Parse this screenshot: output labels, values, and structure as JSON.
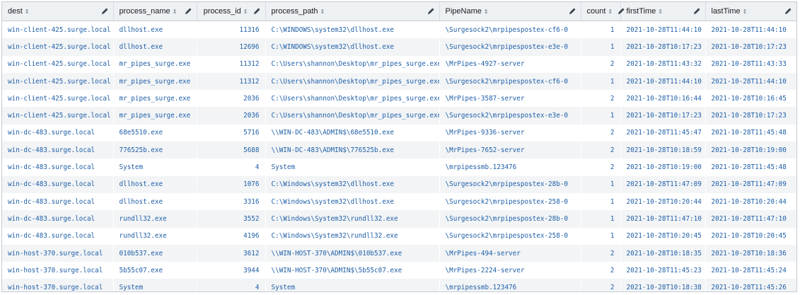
{
  "table": {
    "columns": [
      {
        "label": "dest",
        "sort": "⇕",
        "numeric": false
      },
      {
        "label": "process_name",
        "sort": "⇕",
        "numeric": false
      },
      {
        "label": "process_id",
        "sort": "⇕",
        "numeric": true
      },
      {
        "label": "process_path",
        "sort": "⇕",
        "numeric": false
      },
      {
        "label": "PipeName",
        "sort": "⇕",
        "numeric": false
      },
      {
        "label": "count",
        "sort": "⇕",
        "numeric": true
      },
      {
        "label": "firstTime",
        "sort": "⇕",
        "numeric": false
      },
      {
        "label": "lastTime",
        "sort": "⇕",
        "numeric": false
      }
    ],
    "rows": [
      [
        "win-client-425.surge.local",
        "dllhost.exe",
        "11316",
        "C:\\WINDOWS\\system32\\dllhost.exe",
        "\\Surgesock2\\mrpipespostex-cf6-0",
        "1",
        "2021-10-28T11:44:10",
        "2021-10-28T11:44:10"
      ],
      [
        "win-client-425.surge.local",
        "dllhost.exe",
        "12696",
        "C:\\WINDOWS\\system32\\dllhost.exe",
        "\\Surgesock2\\mrpipespostex-e3e-0",
        "1",
        "2021-10-28T10:17:23",
        "2021-10-28T10:17:23"
      ],
      [
        "win-client-425.surge.local",
        "mr_pipes_surge.exe",
        "11312",
        "C:\\Users\\shannon\\Desktop\\mr_pipes_surge.exe",
        "\\MrPipes-4927-server",
        "2",
        "2021-10-28T11:43:32",
        "2021-10-28T11:43:33"
      ],
      [
        "win-client-425.surge.local",
        "mr_pipes_surge.exe",
        "11312",
        "C:\\Users\\shannon\\Desktop\\mr_pipes_surge.exe",
        "\\Surgesock2\\mrpipespostex-cf6-0",
        "1",
        "2021-10-28T11:44:10",
        "2021-10-28T11:44:10"
      ],
      [
        "win-client-425.surge.local",
        "mr_pipes_surge.exe",
        "2036",
        "C:\\Users\\shannon\\Desktop\\mr_pipes_surge.exe",
        "\\MrPipes-3587-server",
        "2",
        "2021-10-28T10:16:44",
        "2021-10-28T10:16:45"
      ],
      [
        "win-client-425.surge.local",
        "mr_pipes_surge.exe",
        "2036",
        "C:\\Users\\shannon\\Desktop\\mr_pipes_surge.exe",
        "\\Surgesock2\\mrpipespostex-e3e-0",
        "1",
        "2021-10-28T10:17:23",
        "2021-10-28T10:17:23"
      ],
      [
        "win-dc-483.surge.local",
        "68e5510.exe",
        "5716",
        "\\\\WIN-DC-483\\ADMIN$\\68e5510.exe",
        "\\MrPipes-9336-server",
        "2",
        "2021-10-28T11:45:47",
        "2021-10-28T11:45:48"
      ],
      [
        "win-dc-483.surge.local",
        "776525b.exe",
        "5688",
        "\\\\WIN-DC-483\\ADMIN$\\776525b.exe",
        "\\MrPipes-7652-server",
        "2",
        "2021-10-28T10:18:59",
        "2021-10-28T10:19:00"
      ],
      [
        "win-dc-483.surge.local",
        "System",
        "4",
        "System",
        "\\mrpipessmb.123476",
        "2",
        "2021-10-28T10:19:00",
        "2021-10-28T11:45:48"
      ],
      [
        "win-dc-483.surge.local",
        "dllhost.exe",
        "1076",
        "C:\\Windows\\system32\\dllhost.exe",
        "\\Surgesock2\\mrpipespostex-28b-0",
        "1",
        "2021-10-28T11:47:09",
        "2021-10-28T11:47:09"
      ],
      [
        "win-dc-483.surge.local",
        "dllhost.exe",
        "3316",
        "C:\\Windows\\system32\\dllhost.exe",
        "\\Surgesock2\\mrpipespostex-258-0",
        "1",
        "2021-10-28T10:20:44",
        "2021-10-28T10:20:44"
      ],
      [
        "win-dc-483.surge.local",
        "rundll32.exe",
        "3552",
        "C:\\Windows\\System32\\rundll32.exe",
        "\\Surgesock2\\mrpipespostex-28b-0",
        "1",
        "2021-10-28T11:47:10",
        "2021-10-28T11:47:10"
      ],
      [
        "win-dc-483.surge.local",
        "rundll32.exe",
        "4196",
        "C:\\Windows\\System32\\rundll32.exe",
        "\\Surgesock2\\mrpipespostex-258-0",
        "1",
        "2021-10-28T10:20:45",
        "2021-10-28T10:20:45"
      ],
      [
        "win-host-370.surge.local",
        "010b537.exe",
        "3612",
        "\\\\WIN-HOST-370\\ADMIN$\\010b537.exe",
        "\\MrPipes-494-server",
        "2",
        "2021-10-28T10:18:35",
        "2021-10-28T10:18:36"
      ],
      [
        "win-host-370.surge.local",
        "5b55c07.exe",
        "3944",
        "\\\\WIN-HOST-370\\ADMIN$\\5b55c07.exe",
        "\\MrPipes-2224-server",
        "2",
        "2021-10-28T11:45:23",
        "2021-10-28T11:45:24"
      ],
      [
        "win-host-370.surge.local",
        "System",
        "4",
        "System",
        "\\mrpipessmb.123476",
        "2",
        "2021-10-28T10:18:38",
        "2021-10-28T11:45:26"
      ]
    ]
  },
  "colors": {
    "link_text": "#1f5fa8",
    "header_bg": "#eef1f4",
    "stripe_bg": "#f2f4f6",
    "border": "#c3cbd4"
  },
  "icons": {
    "sort": "sort-icon",
    "edit": "pencil-icon"
  }
}
